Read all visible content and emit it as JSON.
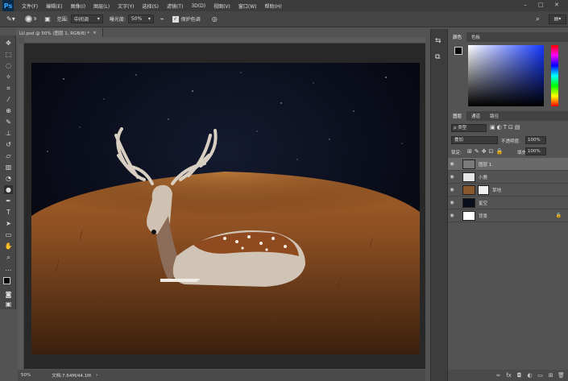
{
  "app": {
    "logo": "Ps"
  },
  "menu": [
    "文件(F)",
    "编辑(E)",
    "图像(I)",
    "图层(L)",
    "文字(Y)",
    "选择(S)",
    "滤镜(T)",
    "3D(D)",
    "视图(V)",
    "窗口(W)",
    "帮助(H)"
  ],
  "options": {
    "size_value": "9",
    "range_label": "范围:",
    "range_value": "中间调",
    "exposure_label": "曝光度:",
    "exposure_value": "50%",
    "protect_tones_label": "保护色调"
  },
  "document": {
    "tab_title": "LU.psd @ 50% (图层 1, RGB/8) *",
    "close": "×"
  },
  "statusbar": {
    "zoom": "50%",
    "doc_info": "文档:7.64M/44.1M"
  },
  "color_panel": {
    "tabs": [
      "颜色",
      "色板"
    ]
  },
  "layers_panel": {
    "tabs": [
      "图层",
      "通道",
      "路径"
    ],
    "filter_kind": "ρ 类型",
    "blend_mode": "叠加",
    "opacity_label": "不透明度:",
    "opacity_value": "100%",
    "lock_label": "锁定:",
    "fill_label": "填充:",
    "fill_value": "100%",
    "layers": [
      {
        "name": "图层 1"
      },
      {
        "name": "小鹿"
      },
      {
        "name": "草地"
      },
      {
        "name": "星空"
      },
      {
        "name": "背景"
      }
    ]
  },
  "colors": {
    "accent": "#0b2b4a",
    "selected_layer": "#6a6a6a"
  }
}
